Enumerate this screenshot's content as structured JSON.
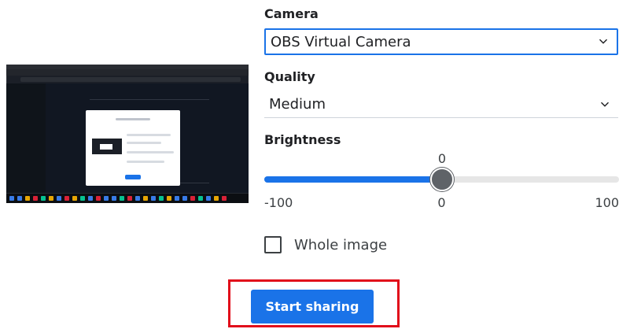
{
  "camera": {
    "label": "Camera",
    "selected": "OBS Virtual Camera",
    "dropdown_icon": "chevron-down-icon"
  },
  "quality": {
    "label": "Quality",
    "selected": "Medium",
    "dropdown_icon": "chevron-down-icon"
  },
  "brightness": {
    "label": "Brightness",
    "value": "0",
    "min": "-100",
    "mid": "0",
    "max": "100",
    "value_fraction": 0.5
  },
  "whole_image": {
    "label": "Whole image",
    "checked": false
  },
  "actions": {
    "start_sharing": "Start sharing"
  },
  "colors": {
    "accent": "#1a73e8",
    "highlight": "#e10d1a"
  }
}
